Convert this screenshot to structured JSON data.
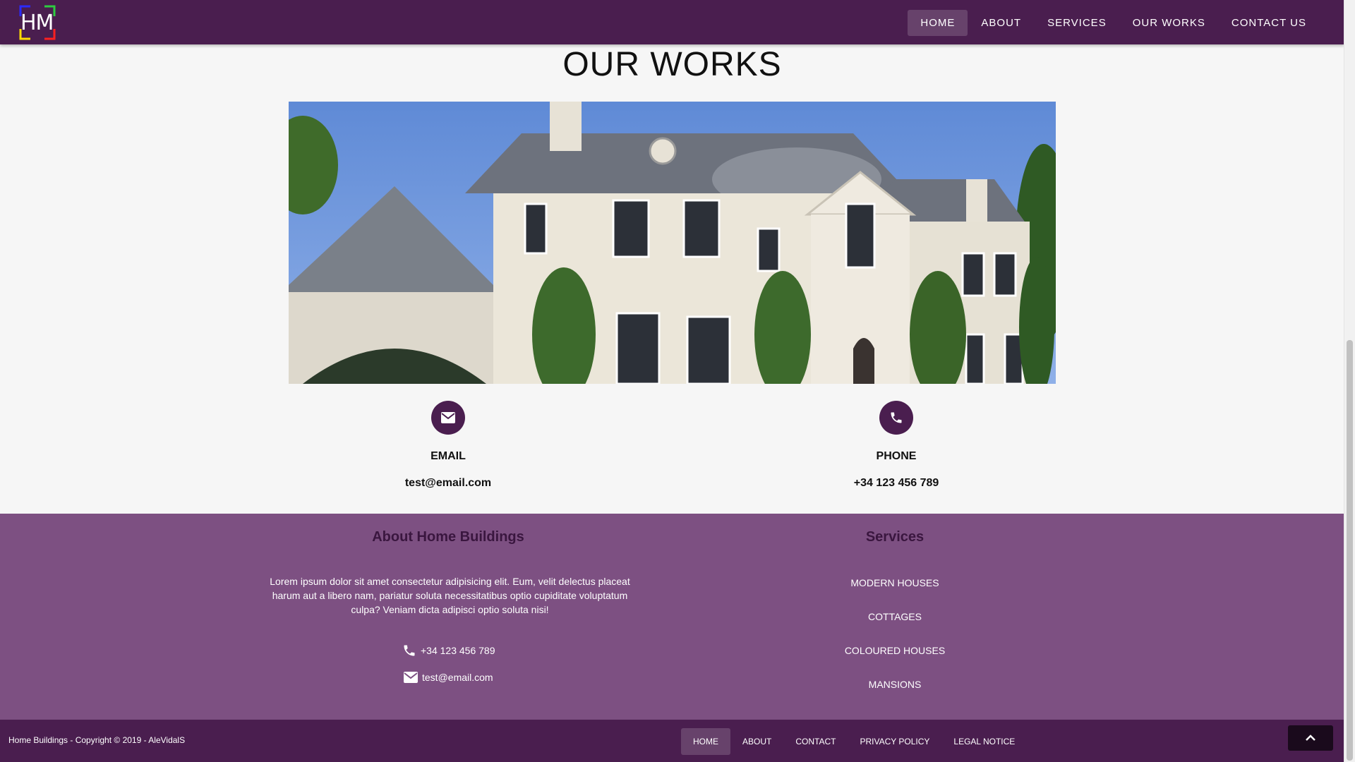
{
  "header": {
    "logo_text": "HM",
    "nav": [
      {
        "label": "HOME"
      },
      {
        "label": "ABOUT"
      },
      {
        "label": "SERVICES"
      },
      {
        "label": "OUR WORKS"
      },
      {
        "label": "CONTACT US"
      }
    ]
  },
  "main": {
    "title": "OUR WORKS",
    "email": {
      "label": "EMAIL",
      "value": "test@email.com"
    },
    "phone": {
      "label": "PHONE",
      "value": "+34 123 456 789"
    }
  },
  "footer": {
    "about_title": "About Home Buildings",
    "about_text": "Lorem ipsum dolor sit amet consectetur adipisicing elit. Eum, velit delectus placeat harum aut a libero nam, pariatur soluta necessitatibus optio cupiditate voluptatum culpa? Veniam dicta adipisci optio soluta nisi!",
    "phone": "+34 123 456 789",
    "email": "test@email.com",
    "services_title": "Services",
    "services": [
      "MODERN HOUSES",
      "COTTAGES",
      "COLOURED HOUSES",
      "MANSIONS"
    ],
    "copyright": "Home Buildings - Copyright © 2019 - AleVidalS",
    "bottom_nav": [
      "HOME",
      "ABOUT",
      "CONTACT",
      "PRIVACY POLICY",
      "LEGAL NOTICE"
    ]
  },
  "colors": {
    "header_bg": "#4a1e4f",
    "footer_bg": "#7d5082",
    "footer_title": "#3a163f"
  },
  "icons": {
    "email": "email-icon",
    "phone": "phone-icon",
    "back_to_top": "chevron-up-icon"
  }
}
